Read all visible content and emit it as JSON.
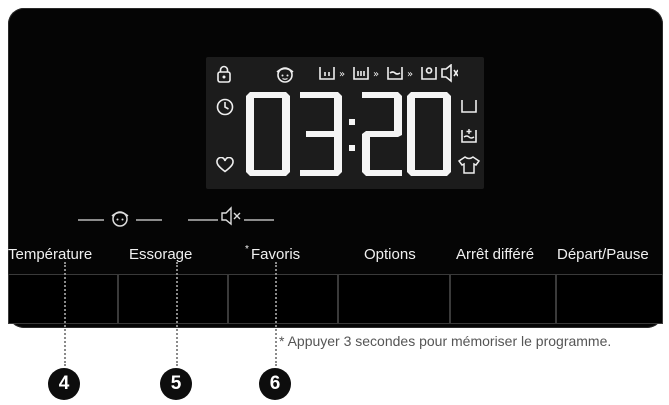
{
  "display": {
    "time": "03:20",
    "icons_left": [
      "lock-icon",
      "clock-icon",
      "heart-icon"
    ],
    "icons_top": [
      "child-lock-icon",
      "tub-icon",
      "tub-icon",
      "tub-icon",
      "tub-icon",
      "mute-icon"
    ],
    "icons_right": [
      "tub-icon",
      "tub-plus-icon",
      "shirt-icon"
    ]
  },
  "buttons": [
    {
      "label": "Température"
    },
    {
      "label": "Essorage"
    },
    {
      "label": "Favoris",
      "marker": "*"
    },
    {
      "label": "Options"
    },
    {
      "label": "Arrêt différé"
    },
    {
      "label": "Départ/Pause"
    }
  ],
  "note": "* Appuyer 3 secondes pour mémoriser le programme.",
  "callouts": [
    "4",
    "5",
    "6"
  ],
  "colors": {
    "panel": "#050505",
    "display": "#1c1c1c",
    "text": "#f0f0f0"
  }
}
